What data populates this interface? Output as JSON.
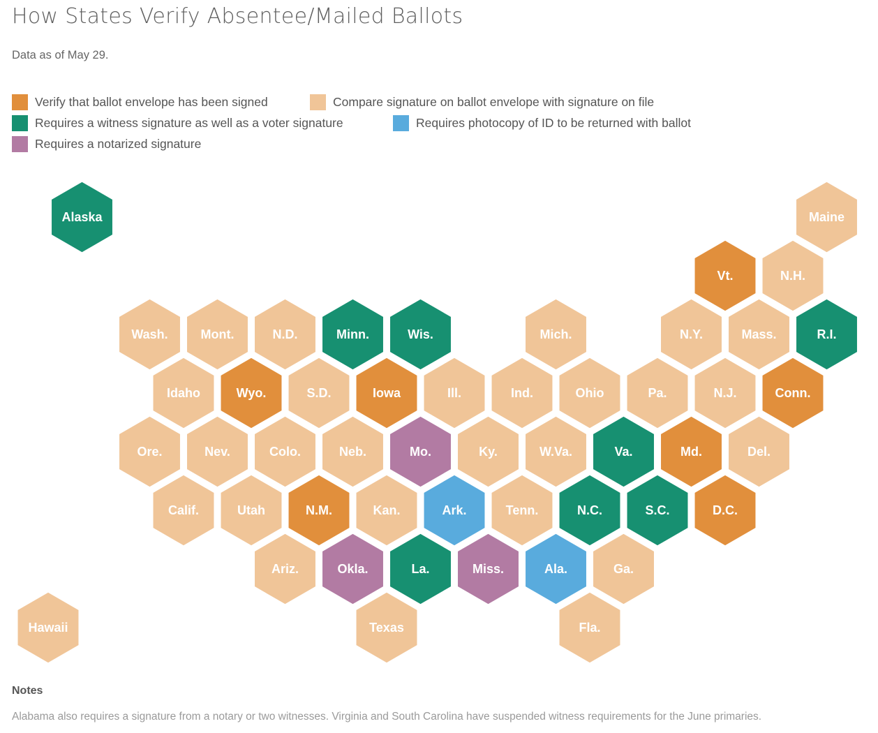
{
  "title": "How States Verify Absentee/Mailed Ballots",
  "subtitle": "Data as of May 29.",
  "categories": {
    "signed": {
      "label": "Verify that ballot envelope has been signed",
      "color": "#E18F3C"
    },
    "compare": {
      "label": "Compare signature on ballot envelope with signature on file",
      "color": "#F0C598"
    },
    "witness": {
      "label": "Requires a witness signature as well as a voter signature",
      "color": "#179071"
    },
    "photo_id": {
      "label": "Requires photocopy of ID to be returned with ballot",
      "color": "#59ABDD"
    },
    "notary": {
      "label": "Requires a notarized signature",
      "color": "#B27BA3"
    }
  },
  "legend": [
    {
      "key": "signed"
    },
    {
      "key": "compare"
    },
    {
      "key": "witness"
    },
    {
      "key": "photo_id"
    },
    {
      "key": "notary"
    }
  ],
  "chart_data": {
    "type": "hex-tile-map",
    "title": "How States Verify Absentee/Mailed Ballots",
    "subtitle": "Data as of May 29.",
    "states": [
      {
        "label": "Alaska",
        "row": 0,
        "col": 1,
        "category": "witness"
      },
      {
        "label": "Maine",
        "row": 0,
        "col": 12,
        "category": "compare"
      },
      {
        "label": "Vt.",
        "row": 1,
        "col": 10,
        "category": "signed"
      },
      {
        "label": "N.H.",
        "row": 1,
        "col": 11,
        "category": "compare"
      },
      {
        "label": "Wash.",
        "row": 2,
        "col": 2,
        "category": "compare"
      },
      {
        "label": "Mont.",
        "row": 2,
        "col": 3,
        "category": "compare"
      },
      {
        "label": "N.D.",
        "row": 2,
        "col": 4,
        "category": "compare"
      },
      {
        "label": "Minn.",
        "row": 2,
        "col": 5,
        "category": "witness"
      },
      {
        "label": "Wis.",
        "row": 2,
        "col": 6,
        "category": "witness"
      },
      {
        "label": "Mich.",
        "row": 2,
        "col": 8,
        "category": "compare"
      },
      {
        "label": "N.Y.",
        "row": 2,
        "col": 10,
        "category": "compare"
      },
      {
        "label": "Mass.",
        "row": 2,
        "col": 11,
        "category": "compare"
      },
      {
        "label": "R.I.",
        "row": 2,
        "col": 12,
        "category": "witness"
      },
      {
        "label": "Idaho",
        "row": 3,
        "col": 2,
        "category": "compare"
      },
      {
        "label": "Wyo.",
        "row": 3,
        "col": 3,
        "category": "signed"
      },
      {
        "label": "S.D.",
        "row": 3,
        "col": 4,
        "category": "compare"
      },
      {
        "label": "Iowa",
        "row": 3,
        "col": 5,
        "category": "signed"
      },
      {
        "label": "Ill.",
        "row": 3,
        "col": 6,
        "category": "compare"
      },
      {
        "label": "Ind.",
        "row": 3,
        "col": 7,
        "category": "compare"
      },
      {
        "label": "Ohio",
        "row": 3,
        "col": 8,
        "category": "compare"
      },
      {
        "label": "Pa.",
        "row": 3,
        "col": 9,
        "category": "compare"
      },
      {
        "label": "N.J.",
        "row": 3,
        "col": 10,
        "category": "compare"
      },
      {
        "label": "Conn.",
        "row": 3,
        "col": 11,
        "category": "signed"
      },
      {
        "label": "Ore.",
        "row": 4,
        "col": 2,
        "category": "compare"
      },
      {
        "label": "Nev.",
        "row": 4,
        "col": 3,
        "category": "compare"
      },
      {
        "label": "Colo.",
        "row": 4,
        "col": 4,
        "category": "compare"
      },
      {
        "label": "Neb.",
        "row": 4,
        "col": 5,
        "category": "compare"
      },
      {
        "label": "Mo.",
        "row": 4,
        "col": 6,
        "category": "notary"
      },
      {
        "label": "Ky.",
        "row": 4,
        "col": 7,
        "category": "compare"
      },
      {
        "label": "W.Va.",
        "row": 4,
        "col": 8,
        "category": "compare"
      },
      {
        "label": "Va.",
        "row": 4,
        "col": 9,
        "category": "witness"
      },
      {
        "label": "Md.",
        "row": 4,
        "col": 10,
        "category": "signed"
      },
      {
        "label": "Del.",
        "row": 4,
        "col": 11,
        "category": "compare"
      },
      {
        "label": "Calif.",
        "row": 5,
        "col": 2,
        "category": "compare"
      },
      {
        "label": "Utah",
        "row": 5,
        "col": 3,
        "category": "compare"
      },
      {
        "label": "N.M.",
        "row": 5,
        "col": 4,
        "category": "signed"
      },
      {
        "label": "Kan.",
        "row": 5,
        "col": 5,
        "category": "compare"
      },
      {
        "label": "Ark.",
        "row": 5,
        "col": 6,
        "category": "photo_id"
      },
      {
        "label": "Tenn.",
        "row": 5,
        "col": 7,
        "category": "compare"
      },
      {
        "label": "N.C.",
        "row": 5,
        "col": 8,
        "category": "witness"
      },
      {
        "label": "S.C.",
        "row": 5,
        "col": 9,
        "category": "witness"
      },
      {
        "label": "D.C.",
        "row": 5,
        "col": 10,
        "category": "signed"
      },
      {
        "label": "Ariz.",
        "row": 6,
        "col": 4,
        "category": "compare"
      },
      {
        "label": "Okla.",
        "row": 6,
        "col": 5,
        "category": "notary"
      },
      {
        "label": "La.",
        "row": 6,
        "col": 6,
        "category": "witness"
      },
      {
        "label": "Miss.",
        "row": 6,
        "col": 7,
        "category": "notary"
      },
      {
        "label": "Ala.",
        "row": 6,
        "col": 8,
        "category": "photo_id"
      },
      {
        "label": "Ga.",
        "row": 6,
        "col": 9,
        "category": "compare"
      },
      {
        "label": "Hawaii",
        "row": 7,
        "col": 0,
        "category": "compare"
      },
      {
        "label": "Texas",
        "row": 7,
        "col": 5,
        "category": "compare"
      },
      {
        "label": "Fla.",
        "row": 7,
        "col": 8,
        "category": "compare"
      }
    ]
  },
  "notes": {
    "heading": "Notes",
    "text": "Alabama also requires a signature from a notary or two witnesses. Virginia and South Carolina have suspended witness requirements for the June primaries."
  }
}
